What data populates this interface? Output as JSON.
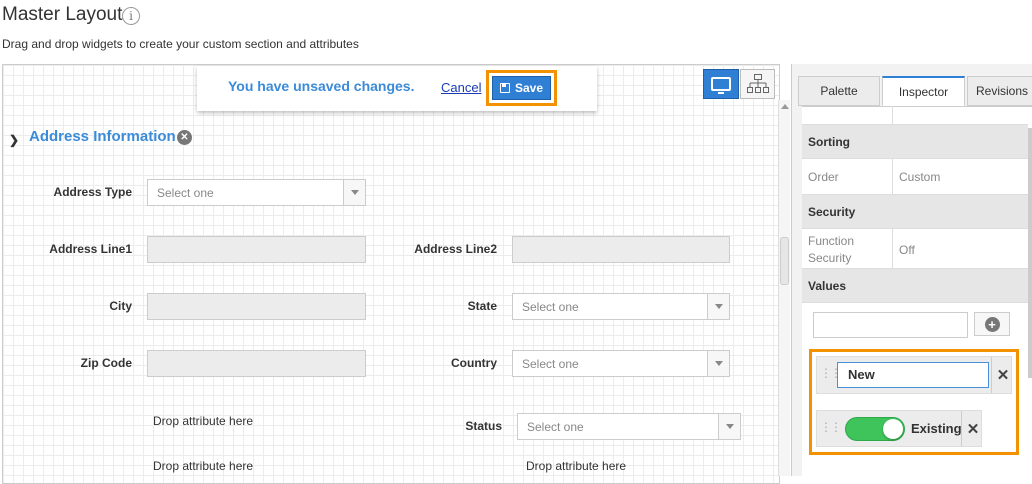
{
  "header": {
    "title": "Master Layout",
    "info_icon": "i",
    "subtitle": "Drag and drop widgets to create your custom section and attributes"
  },
  "unsaved_bar": {
    "message": "You have unsaved changes.",
    "cancel_label": "Cancel",
    "save_label": "Save"
  },
  "device_toggle": {
    "active": "desktop-view",
    "options": [
      "desktop-view",
      "tree-view"
    ]
  },
  "section": {
    "title": "Address Information",
    "fields": {
      "address_type": {
        "label": "Address Type",
        "placeholder": "Select one"
      },
      "address_line1": {
        "label": "Address Line1",
        "value": ""
      },
      "address_line2": {
        "label": "Address Line2",
        "value": ""
      },
      "city": {
        "label": "City",
        "value": ""
      },
      "state": {
        "label": "State",
        "placeholder": "Select one"
      },
      "zip_code": {
        "label": "Zip Code",
        "value": ""
      },
      "country": {
        "label": "Country",
        "placeholder": "Select one"
      },
      "status": {
        "label": "Status",
        "placeholder": "Select one"
      }
    },
    "drop_placeholder": "Drop attribute here"
  },
  "panel": {
    "tabs": [
      {
        "label": "Palette",
        "active": false
      },
      {
        "label": "Inspector",
        "active": true
      },
      {
        "label": "Revisions",
        "active": false
      }
    ],
    "inspector": {
      "sorting_heading": "Sorting",
      "order_key": "Order",
      "order_value": "Custom",
      "security_heading": "Security",
      "function_security_key_line1": "Function",
      "function_security_key_line2": "Security",
      "function_security_value": "Off",
      "values_heading": "Values",
      "new_value_input": "",
      "values": [
        {
          "label": "New",
          "editing": true
        },
        {
          "label": "Existing",
          "enabled": true
        }
      ]
    }
  },
  "colors": {
    "accent": "#2f7fd4",
    "link_blue": "#3b8bd8",
    "highlight": "#f39200",
    "toggle_on": "#3ec45a"
  }
}
